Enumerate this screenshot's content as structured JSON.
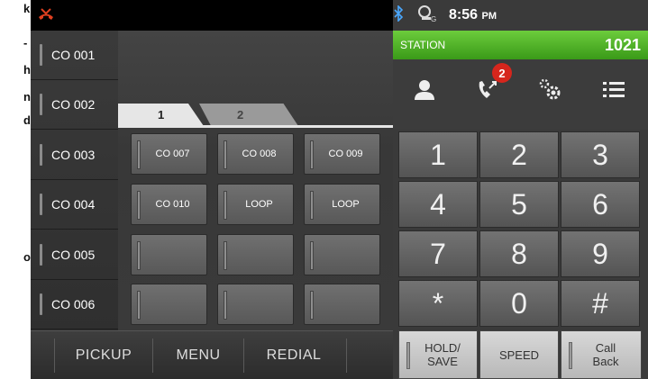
{
  "side_chars": [
    "k",
    "-",
    "h",
    "n",
    "d",
    "o"
  ],
  "status": {
    "time": "8:56",
    "ampm": "PM",
    "icons": [
      "missed-call-icon",
      "bluetooth-icon",
      "gps-sync-icon"
    ]
  },
  "co_lines": [
    "CO 001",
    "CO 002",
    "CO 003",
    "CO 004",
    "CO 005",
    "CO 006"
  ],
  "tabs": [
    "1",
    "2"
  ],
  "line_buttons": [
    "CO 007",
    "CO 008",
    "CO 009",
    "CO 010",
    "LOOP",
    "LOOP",
    "",
    "",
    "",
    "",
    "",
    ""
  ],
  "bottom_bar": [
    "PICKUP",
    "MENU",
    "REDIAL"
  ],
  "station": {
    "label": "STATION",
    "number": "1021"
  },
  "call_badge": "2",
  "toolbar_icons": [
    "contacts-icon",
    "call-log-icon",
    "settings-icon",
    "list-icon"
  ],
  "keypad": [
    "1",
    "2",
    "3",
    "4",
    "5",
    "6",
    "7",
    "8",
    "9",
    "*",
    "0",
    "#"
  ],
  "right_buttons": {
    "hold": "HOLD/ SAVE",
    "speed": "SPEED",
    "callback": "Call Back"
  },
  "colors": {
    "station_green": "#4caf2a",
    "badge_red": "#d6261d",
    "missed_call_red": "#e04020"
  }
}
